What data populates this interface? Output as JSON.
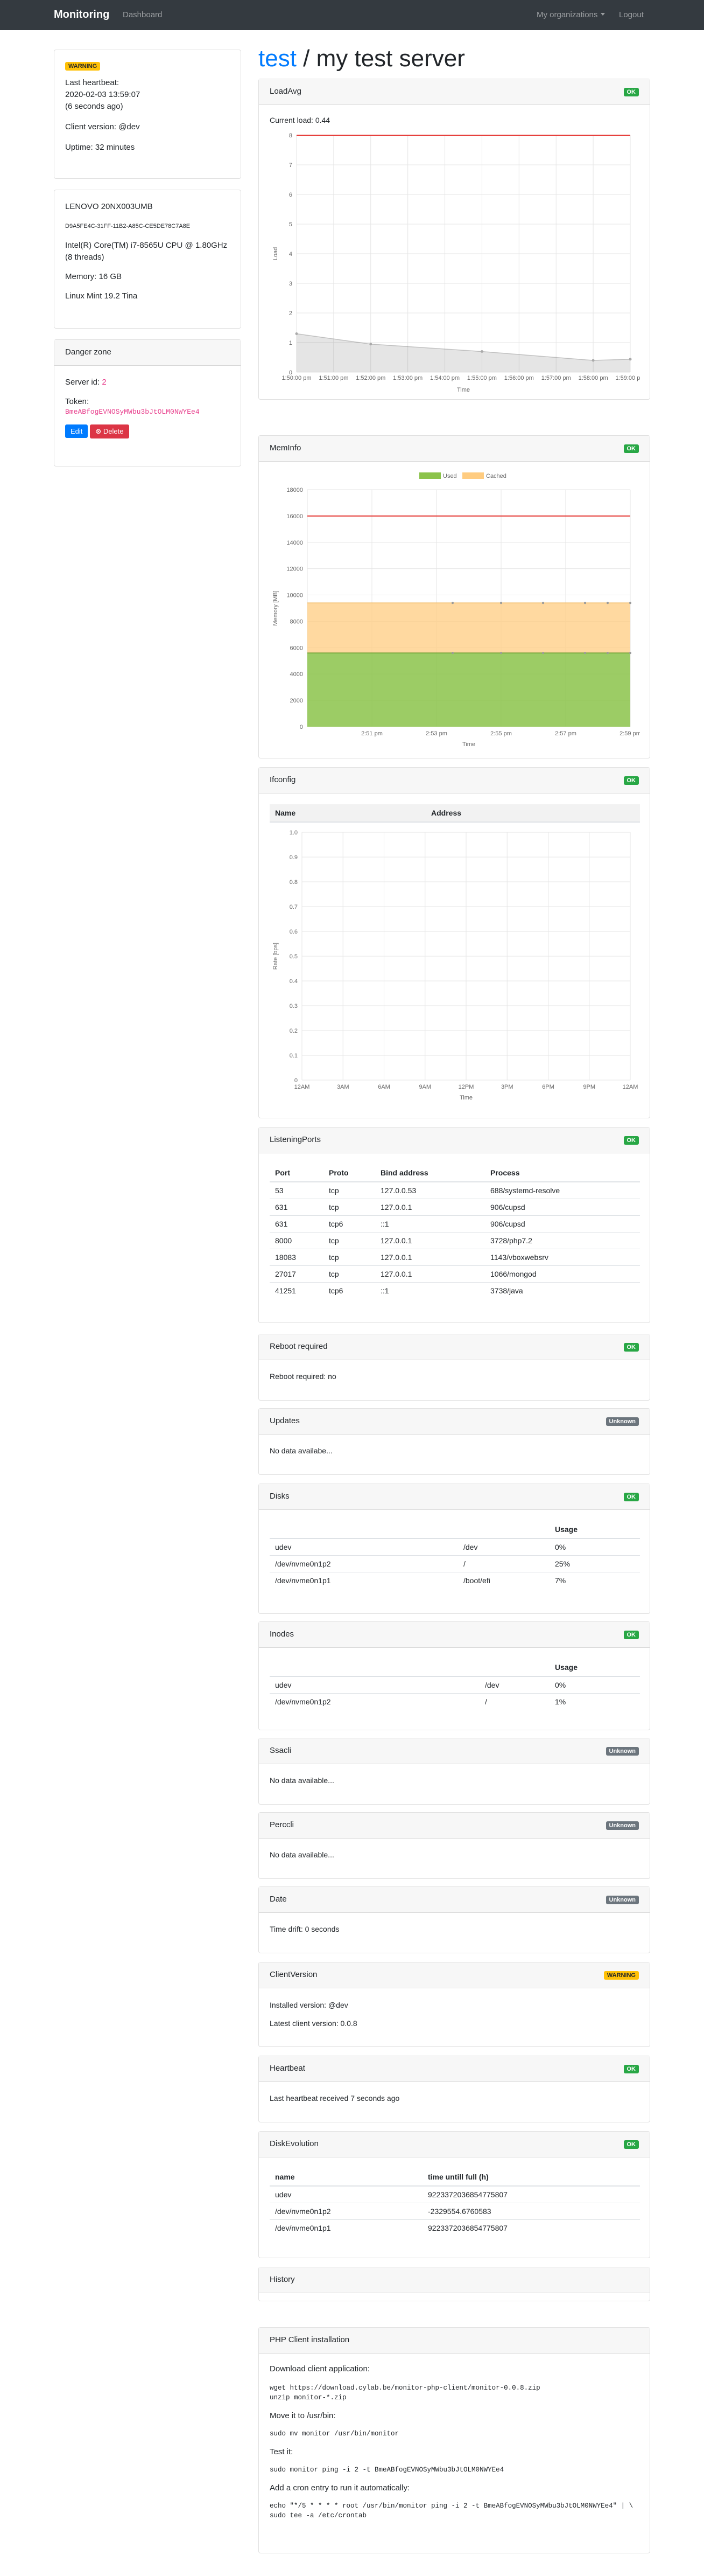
{
  "navbar": {
    "brand": "Monitoring",
    "dashboard": "Dashboard",
    "organizations": "My organizations",
    "logout": "Logout"
  },
  "header": {
    "org": "test",
    "separator": " / ",
    "server": "my test server"
  },
  "status_card": {
    "badge": "WARNING",
    "last_heartbeat_label": "Last heartbeat:",
    "last_heartbeat": "2020-02-03 13:59:07",
    "ago": "(6 seconds ago)",
    "client_version": "Client version: @dev",
    "uptime": "Uptime: 32 minutes"
  },
  "hardware_card": {
    "model": "LENOVO 20NX003UMB",
    "uuid": "D9A5FE4C-31FF-11B2-A85C-CE5DE78C7A8E",
    "cpu": "Intel(R) Core(TM) i7-8565U CPU @ 1.80GHz (8 threads)",
    "memory": "Memory: 16 GB",
    "os": "Linux Mint 19.2 Tina"
  },
  "danger_zone": {
    "title": "Danger zone",
    "server_id_label": "Server id: ",
    "server_id": "2",
    "token_label": "Token:",
    "token": "BmeABfogEVNOSyMWbu3bJtOLM0NWYEe4",
    "edit": "Edit",
    "delete": "Delete"
  },
  "colors": {
    "ok": "#28a745",
    "unknown": "#6c757d",
    "warning": "#ffc107",
    "link": "#007bff",
    "used": "#8bc34a",
    "cached": "#ffcc80",
    "limit": "#e53935"
  },
  "loadavg": {
    "title": "LoadAvg",
    "badge": "OK",
    "current": "Current load: 0.44",
    "xlabel": "Time",
    "ylabel": "Load",
    "yticks": [
      "0",
      "1",
      "2",
      "3",
      "4",
      "5",
      "6",
      "7",
      "8"
    ],
    "xticks": [
      "1:50:00 pm",
      "1:51:00 pm",
      "1:52:00 pm",
      "1:53:00 pm",
      "1:54:00 pm",
      "1:55:00 pm",
      "1:56:00 pm",
      "1:57:00 pm",
      "1:58:00 pm",
      "1:59:00 pm"
    ]
  },
  "meminfo": {
    "title": "MemInfo",
    "badge": "OK",
    "legend": [
      "Used",
      "Cached"
    ],
    "xlabel": "Time",
    "ylabel": "Memory [MB]",
    "yticks": [
      "0",
      "2000",
      "4000",
      "6000",
      "8000",
      "10000",
      "12000",
      "14000",
      "16000",
      "18000"
    ],
    "xticks": [
      "2:51 pm",
      "2:53 pm",
      "2:55 pm",
      "2:57 pm",
      "2:59 pm"
    ]
  },
  "ifconfig": {
    "title": "Ifconfig",
    "badge": "OK",
    "columns": [
      "Name",
      "Address"
    ],
    "xlabel": "Time",
    "ylabel": "Rate [bps]",
    "yticks": [
      "0",
      "0.1",
      "0.2",
      "0.3",
      "0.4",
      "0.5",
      "0.6",
      "0.7",
      "0.8",
      "0.9",
      "1.0"
    ],
    "xticks": [
      "12AM",
      "3AM",
      "6AM",
      "9AM",
      "12PM",
      "3PM",
      "6PM",
      "9PM",
      "12AM"
    ]
  },
  "chart_data": [
    {
      "type": "area",
      "title": "LoadAvg",
      "xlabel": "Time",
      "ylabel": "Load",
      "ylim": [
        0,
        8
      ],
      "x": [
        "1:50:00 pm",
        "1:52:00 pm",
        "1:55:00 pm",
        "1:58:00 pm",
        "1:59:00 pm"
      ],
      "series": [
        {
          "name": "",
          "values": [
            1.3,
            0.95,
            0.7,
            0.4,
            0.44
          ]
        }
      ],
      "limit": 8
    },
    {
      "type": "area",
      "title": "MemInfo",
      "xlabel": "Time",
      "ylabel": "Memory [MB]",
      "ylim": [
        0,
        18000
      ],
      "x": [
        "2:50 pm",
        "2:51 pm",
        "2:53 pm",
        "2:55 pm",
        "2:57 pm",
        "2:59 pm"
      ],
      "series": [
        {
          "name": "Used",
          "values": [
            5600,
            5600,
            5600,
            5600,
            5600,
            5600
          ]
        },
        {
          "name": "Cached",
          "values": [
            9400,
            9400,
            9400,
            9400,
            9400,
            9400
          ]
        }
      ],
      "limit": 16000
    },
    {
      "type": "line",
      "title": "Ifconfig",
      "xlabel": "Time",
      "ylabel": "Rate [bps]",
      "ylim": [
        0,
        1
      ],
      "x": [],
      "series": []
    }
  ],
  "listening_ports": {
    "title": "ListeningPorts",
    "badge": "OK",
    "columns": [
      "Port",
      "Proto",
      "Bind address",
      "Process"
    ],
    "rows": [
      [
        "53",
        "tcp",
        "127.0.0.53",
        "688/systemd-resolve"
      ],
      [
        "631",
        "tcp",
        "127.0.0.1",
        "906/cupsd"
      ],
      [
        "631",
        "tcp6",
        "::1",
        "906/cupsd"
      ],
      [
        "8000",
        "tcp",
        "127.0.0.1",
        "3728/php7.2"
      ],
      [
        "18083",
        "tcp",
        "127.0.0.1",
        "1143/vboxwebsrv"
      ],
      [
        "27017",
        "tcp",
        "127.0.0.1",
        "1066/mongod"
      ],
      [
        "41251",
        "tcp6",
        "::1",
        "3738/java"
      ]
    ]
  },
  "reboot": {
    "title": "Reboot required",
    "badge": "OK",
    "text": "Reboot required: no"
  },
  "updates": {
    "title": "Updates",
    "badge": "Unknown",
    "text": "No data availabe..."
  },
  "disks": {
    "title": "Disks",
    "badge": "OK",
    "usage_header": "Usage",
    "rows": [
      [
        "udev",
        "/dev",
        "0%"
      ],
      [
        "/dev/nvme0n1p2",
        "/",
        "25%"
      ],
      [
        "/dev/nvme0n1p1",
        "/boot/efi",
        "7%"
      ]
    ]
  },
  "inodes": {
    "title": "Inodes",
    "badge": "OK",
    "usage_header": "Usage",
    "rows": [
      [
        "udev",
        "/dev",
        "0%"
      ],
      [
        "/dev/nvme0n1p2",
        "/",
        "1%"
      ]
    ]
  },
  "ssacli": {
    "title": "Ssacli",
    "badge": "Unknown",
    "text": "No data available..."
  },
  "perccli": {
    "title": "Perccli",
    "badge": "Unknown",
    "text": "No data available..."
  },
  "date": {
    "title": "Date",
    "badge": "Unknown",
    "text": "Time drift: 0 seconds"
  },
  "client_version": {
    "title": "ClientVersion",
    "badge": "WARNING",
    "installed": "Installed version: @dev",
    "latest": "Latest client version: 0.0.8"
  },
  "heartbeat": {
    "title": "Heartbeat",
    "badge": "OK",
    "text": "Last heartbeat received 7 seconds ago"
  },
  "disk_evolution": {
    "title": "DiskEvolution",
    "badge": "OK",
    "columns": [
      "name",
      "time untill full (h)"
    ],
    "rows": [
      [
        "udev",
        "9223372036854775807"
      ],
      [
        "/dev/nvme0n1p2",
        "-2329554.6760583"
      ],
      [
        "/dev/nvme0n1p1",
        "9223372036854775807"
      ]
    ]
  },
  "history": {
    "title": "History"
  },
  "php_client": {
    "title": "PHP Client installation",
    "download_label": "Download client application:",
    "download_code": "wget https://download.cylab.be/monitor-php-client/monitor-0.0.8.zip\nunzip monitor-*.zip",
    "move_label": "Move it to /usr/bin:",
    "move_code": "sudo mv monitor /usr/bin/monitor",
    "test_label": "Test it:",
    "test_code": "sudo monitor ping -i 2 -t BmeABfogEVNOSyMWbu3bJtOLM0NWYEe4",
    "cron_label": "Add a cron entry to run it automatically:",
    "cron_code": "echo \"*/5 * * * * root /usr/bin/monitor ping -i 2 -t BmeABfogEVNOSyMWbu3bJtOLM0NWYEe4\" | \\\nsudo tee -a /etc/crontab"
  }
}
